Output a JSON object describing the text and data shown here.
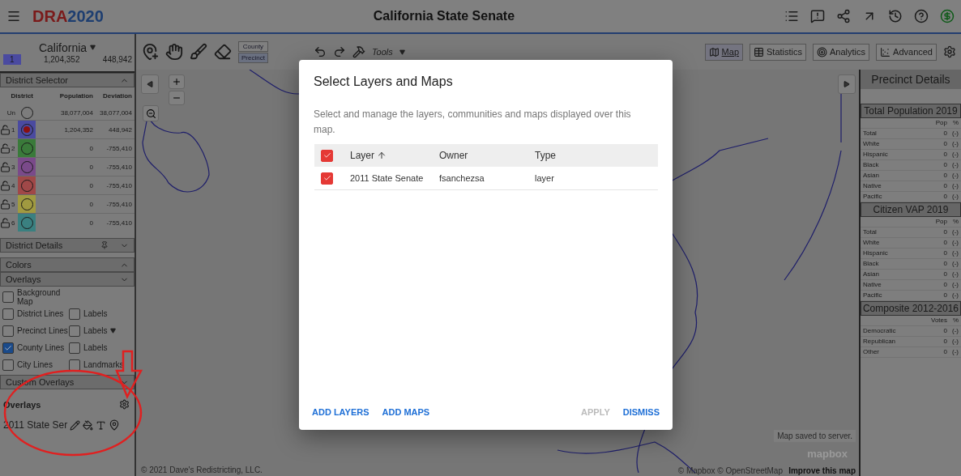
{
  "header": {
    "logo": {
      "part_1": "DRA",
      "part_2": "2020"
    },
    "title": "California State Senate"
  },
  "sidebar": {
    "state": "California",
    "summary": {
      "district": "1",
      "population": "1,204,352",
      "deviation": "448,942"
    },
    "district_selector": {
      "title": "District Selector",
      "expanded": true,
      "columns": [
        "District",
        "Population",
        "Deviation"
      ],
      "unassigned": {
        "label": "Un",
        "population": "38,077,004",
        "deviation": "38,077,004",
        "selected": false
      },
      "rows": [
        {
          "label": "1",
          "population": "1,204,352",
          "deviation": "448,942",
          "color": "#4a4aa0",
          "selected": true,
          "locked": false
        },
        {
          "label": "2",
          "population": "0",
          "deviation": "-755,410",
          "color": "#3a7a3a",
          "selected": false,
          "locked": false
        },
        {
          "label": "3",
          "population": "0",
          "deviation": "-755,410",
          "color": "#7a4a8a",
          "selected": false,
          "locked": false
        },
        {
          "label": "4",
          "population": "0",
          "deviation": "-755,410",
          "color": "#a04848",
          "selected": false,
          "locked": false
        },
        {
          "label": "5",
          "population": "0",
          "deviation": "-755,410",
          "color": "#a09a40",
          "selected": false,
          "locked": false
        },
        {
          "label": "6",
          "population": "0",
          "deviation": "-755,410",
          "color": "#3a8080",
          "selected": false,
          "locked": false
        }
      ]
    },
    "sections": [
      {
        "title": "District Details",
        "expanded": false,
        "pinned": true
      },
      {
        "title": "Colors",
        "expanded": true,
        "pinned": false
      },
      {
        "title": "Overlays",
        "expanded": false,
        "pinned": false
      }
    ],
    "overlay_rows": [
      [
        {
          "label": "Background Map",
          "checked": false,
          "dropdown": false
        }
      ],
      [
        {
          "label": "District Lines",
          "checked": false,
          "dropdown": false
        },
        {
          "label": "Labels",
          "checked": false,
          "dropdown": false
        }
      ],
      [
        {
          "label": "Precinct Lines",
          "checked": false,
          "dropdown": false
        },
        {
          "label": "Labels",
          "checked": false,
          "dropdown": true
        }
      ],
      [
        {
          "label": "County Lines",
          "checked": true,
          "dropdown": false
        },
        {
          "label": "Labels",
          "checked": false,
          "dropdown": false
        }
      ],
      [
        {
          "label": "City Lines",
          "checked": false,
          "dropdown": false
        },
        {
          "label": "Landmarks",
          "checked": false,
          "dropdown": false
        }
      ]
    ],
    "custom_overlays": {
      "title": "Custom Overlays",
      "expanded": false,
      "heading": "Overlays",
      "items": [
        {
          "name": "2011 State Ser"
        }
      ]
    }
  },
  "toolbar": {
    "units": [
      {
        "label": "County",
        "selected": false
      },
      {
        "label": "Precinct",
        "selected": true
      }
    ],
    "tools_menu": "Tools"
  },
  "view_tabs": [
    {
      "label": "Map",
      "selected": true,
      "kind": "map"
    },
    {
      "label": "Statistics",
      "selected": false,
      "kind": "table"
    },
    {
      "label": "Analytics",
      "selected": false,
      "kind": "target"
    },
    {
      "label": "Advanced",
      "selected": false,
      "kind": "scatter"
    }
  ],
  "map": {
    "copyright": "© 2021 Dave's Redistricting, LLC.",
    "status": "Map saved to server.",
    "mapbox_logo": "mapbox",
    "attribution": "© Mapbox © OpenStreetMap",
    "improve_link": "Improve this map"
  },
  "precinct_details": {
    "title": "Precinct Details",
    "sections": [
      {
        "title": "Total Population 2019",
        "columns": [
          "",
          "Pop",
          "%"
        ],
        "rows": [
          [
            "Total",
            "0",
            "(-)"
          ],
          [
            "White",
            "0",
            "(-)"
          ],
          [
            "Hispanic",
            "0",
            "(-)"
          ],
          [
            "Black",
            "0",
            "(-)"
          ],
          [
            "Asian",
            "0",
            "(-)"
          ],
          [
            "Native",
            "0",
            "(-)"
          ],
          [
            "Pacific",
            "0",
            "(-)"
          ]
        ]
      },
      {
        "title": "Citizen VAP 2019",
        "columns": [
          "",
          "Pop",
          "%"
        ],
        "rows": [
          [
            "Total",
            "0",
            "(-)"
          ],
          [
            "White",
            "0",
            "(-)"
          ],
          [
            "Hispanic",
            "0",
            "(-)"
          ],
          [
            "Black",
            "0",
            "(-)"
          ],
          [
            "Asian",
            "0",
            "(-)"
          ],
          [
            "Native",
            "0",
            "(-)"
          ],
          [
            "Pacific",
            "0",
            "(-)"
          ]
        ]
      },
      {
        "title": "Composite 2012-2016",
        "columns": [
          "",
          "Votes",
          "%"
        ],
        "rows": [
          [
            "Democratic",
            "0",
            "(-)"
          ],
          [
            "Republican",
            "0",
            "(-)"
          ],
          [
            "Other",
            "0",
            "(-)"
          ]
        ]
      }
    ]
  },
  "dialog": {
    "title": "Select Layers and Maps",
    "description": "Select and manage the layers, communities and maps displayed over this map.",
    "all_checked": true,
    "columns": [
      {
        "label": "Layer",
        "sorted": true
      },
      {
        "label": "Owner",
        "sorted": false
      },
      {
        "label": "Type",
        "sorted": false
      }
    ],
    "rows": [
      {
        "layer": "2011 State Senate",
        "owner": "fsanchezsa",
        "type": "layer",
        "checked": true
      }
    ],
    "buttons": [
      {
        "label": "ADD LAYERS",
        "disabled": false
      },
      {
        "label": "ADD MAPS",
        "disabled": false
      },
      {
        "label": "APPLY",
        "disabled": true
      },
      {
        "label": "DISMISS",
        "disabled": false
      }
    ]
  }
}
